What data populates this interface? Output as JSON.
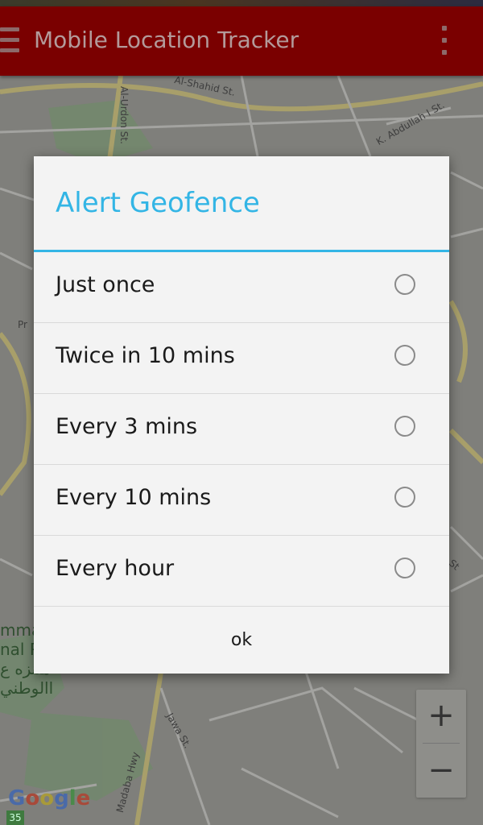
{
  "app_bar": {
    "title": "Mobile Location Tracker",
    "menu_icon": "hamburger-menu-icon",
    "overflow_icon": "overflow-menu-icon",
    "color": "#7a0000"
  },
  "map": {
    "street_labels": [
      "Al-Shahid St.",
      "Al-Urdon St.",
      "K. Abdullah I St.",
      "Jawa St.",
      "Madaba Hwy",
      "Pr",
      "St"
    ],
    "area_label_lines": [
      "mma",
      "nal P",
      "متنزه ع",
      "االوطني"
    ],
    "route_badge": "35",
    "attribution": [
      "G",
      "o",
      "o",
      "g",
      "l",
      "e"
    ],
    "zoom_in_label": "+",
    "zoom_out_label": "−"
  },
  "dialog": {
    "title": "Alert Geofence",
    "accent_color": "#33b5e5",
    "options": [
      {
        "label": "Just once",
        "selected": false
      },
      {
        "label": "Twice in 10 mins",
        "selected": false
      },
      {
        "label": "Every 3 mins",
        "selected": false
      },
      {
        "label": "Every 10 mins",
        "selected": false
      },
      {
        "label": "Every hour",
        "selected": false
      }
    ],
    "ok_label": "ok"
  }
}
